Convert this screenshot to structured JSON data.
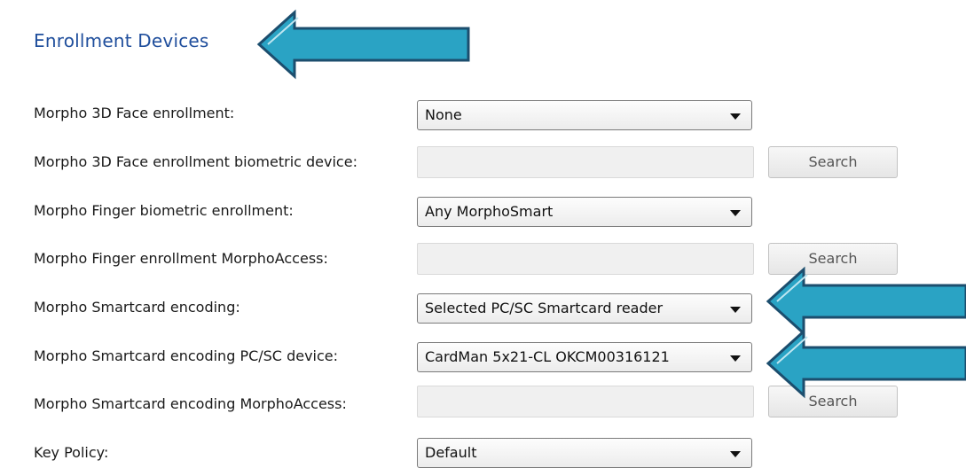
{
  "section": {
    "title": "Enrollment Devices"
  },
  "rows": [
    {
      "label": "Morpho 3D Face enrollment:",
      "type": "select",
      "value": "None"
    },
    {
      "label": "Morpho 3D Face enrollment biometric device:",
      "type": "input",
      "value": "",
      "button": "Search"
    },
    {
      "label": "Morpho Finger biometric enrollment:",
      "type": "select",
      "value": "Any MorphoSmart"
    },
    {
      "label": "Morpho Finger enrollment MorphoAccess:",
      "type": "input",
      "value": "",
      "button": "Search"
    },
    {
      "label": "Morpho Smartcard encoding:",
      "type": "select",
      "value": "Selected PC/SC Smartcard reader"
    },
    {
      "label": "Morpho Smartcard encoding PC/SC device:",
      "type": "select",
      "value": "CardMan 5x21-CL OKCM00316121"
    },
    {
      "label": "Morpho Smartcard encoding MorphoAccess:",
      "type": "input",
      "value": "",
      "button": "Search"
    },
    {
      "label": "Key Policy:",
      "type": "select",
      "value": "Default"
    }
  ],
  "colors": {
    "title": "#1f4e9c",
    "arrow_fill": "#2aa3c4",
    "arrow_stroke": "#1c4e6e"
  },
  "annotations": [
    "arrow-icon",
    "arrow-icon",
    "arrow-icon"
  ]
}
